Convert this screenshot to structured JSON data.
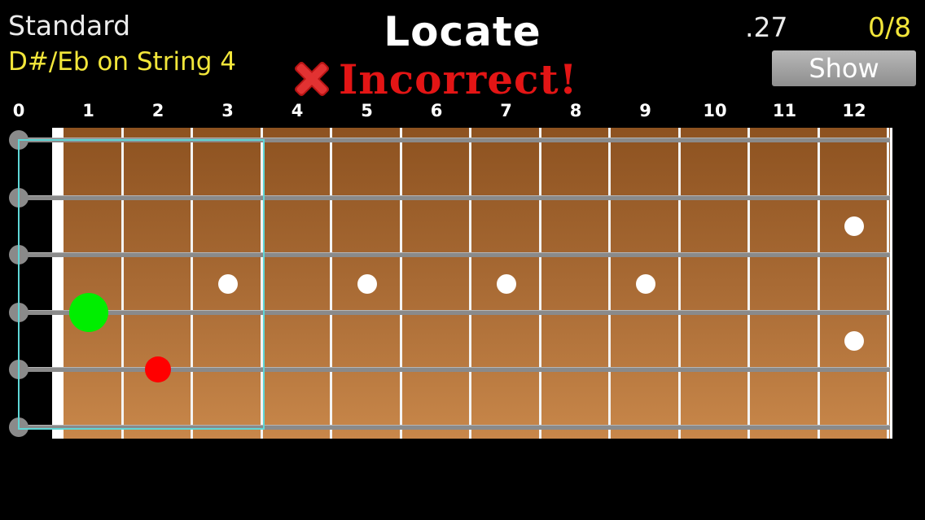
{
  "header": {
    "tuning": "Standard",
    "target_note": "D#/Eb on String 4",
    "title": "Locate",
    "result_text": "Incorrect!",
    "result_icon": "red-x-icon",
    "timer": ".27",
    "score": "0/8",
    "show_label": "Show"
  },
  "fretboard": {
    "fret_numbers": [
      "0",
      "1",
      "2",
      "3",
      "4",
      "5",
      "6",
      "7",
      "8",
      "9",
      "10",
      "11",
      "12"
    ],
    "strings": 6,
    "inlays_single": [
      3,
      5,
      7,
      9
    ],
    "inlays_double": [
      12
    ],
    "correct_position": {
      "string": 4,
      "fret": 1,
      "color": "#00ee00"
    },
    "wrong_position": {
      "string": 5,
      "fret": 2,
      "color": "#ff0000"
    },
    "highlight_range": {
      "from_fret": 0,
      "to_fret": 3,
      "color": "#5fd6d6"
    }
  },
  "colors": {
    "accent_yellow": "#f2e63a",
    "incorrect_red": "#e31515",
    "button_gray": "#a3a3a3"
  }
}
